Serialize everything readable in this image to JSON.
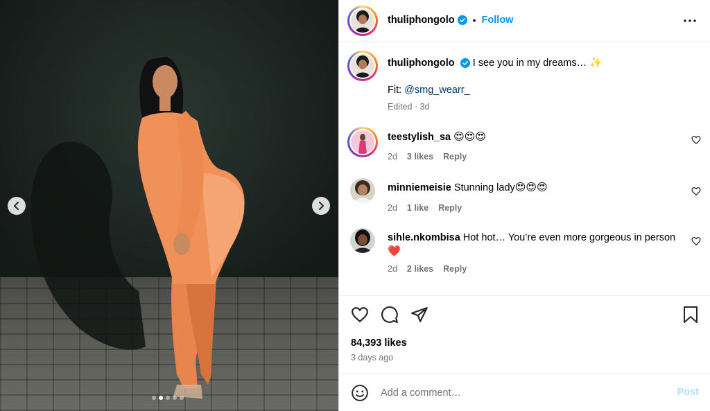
{
  "media": {
    "carousel": {
      "slide_count": 5,
      "active_index": 1
    }
  },
  "header": {
    "username": "thuliphongolo",
    "separator": "•",
    "follow_label": "Follow"
  },
  "caption": {
    "username": "thuliphongolo",
    "text": "I see you in my dreams…",
    "emoji": "✨",
    "fit_label": "Fit:",
    "fit_mention": "@smg_wearr_",
    "edited": "Edited",
    "dot": "·",
    "age": "3d"
  },
  "comments": [
    {
      "username": "teestylish_sa",
      "text": "",
      "emojis": "😍😍😍",
      "age": "2d",
      "likes": "3 likes",
      "reply": "Reply"
    },
    {
      "username": "minniemeisie",
      "text": "Stunning lady",
      "emojis": "😍😍😍",
      "age": "2d",
      "likes": "1 like",
      "reply": "Reply"
    },
    {
      "username": "sihle.nkombisa",
      "text": "Hot hot… You’re even more gorgeous in person",
      "emojis": "❤️",
      "age": "2d",
      "likes": "2 likes",
      "reply": "Reply"
    }
  ],
  "stats": {
    "likes": "84,393 likes",
    "posted": "3 days ago"
  },
  "add_comment": {
    "placeholder": "Add a comment…",
    "post_label": "Post"
  },
  "colors": {
    "accent": "#0095f6",
    "verified": "#0095f6",
    "muted": "#737373",
    "mention": "#00376b",
    "post_disabled": "#b2dffc"
  }
}
